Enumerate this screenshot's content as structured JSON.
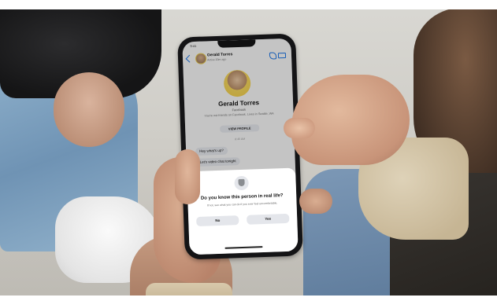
{
  "chat": {
    "status_time": "9:41",
    "contact_name": "Gerald Torres",
    "contact_status": "Active 20m ago",
    "profile_name": "Gerald Torres",
    "profile_platform": "Facebook",
    "profile_friends_note": "You're not friends on Facebook. Lives in Seattle, WA",
    "view_profile_label": "VIEW PROFILE",
    "timestamp": "8:45 AM",
    "messages": [
      "Hey what's up?",
      "Let's video chat tonight"
    ]
  },
  "prompt": {
    "title": "Do you know this person in real life?",
    "body": "If not, see what you can do if you ever feel uncomfortable.",
    "no_label": "No",
    "yes_label": "Yes"
  },
  "icons": [
    "back-icon",
    "phone-icon",
    "video-icon",
    "shield-icon"
  ]
}
